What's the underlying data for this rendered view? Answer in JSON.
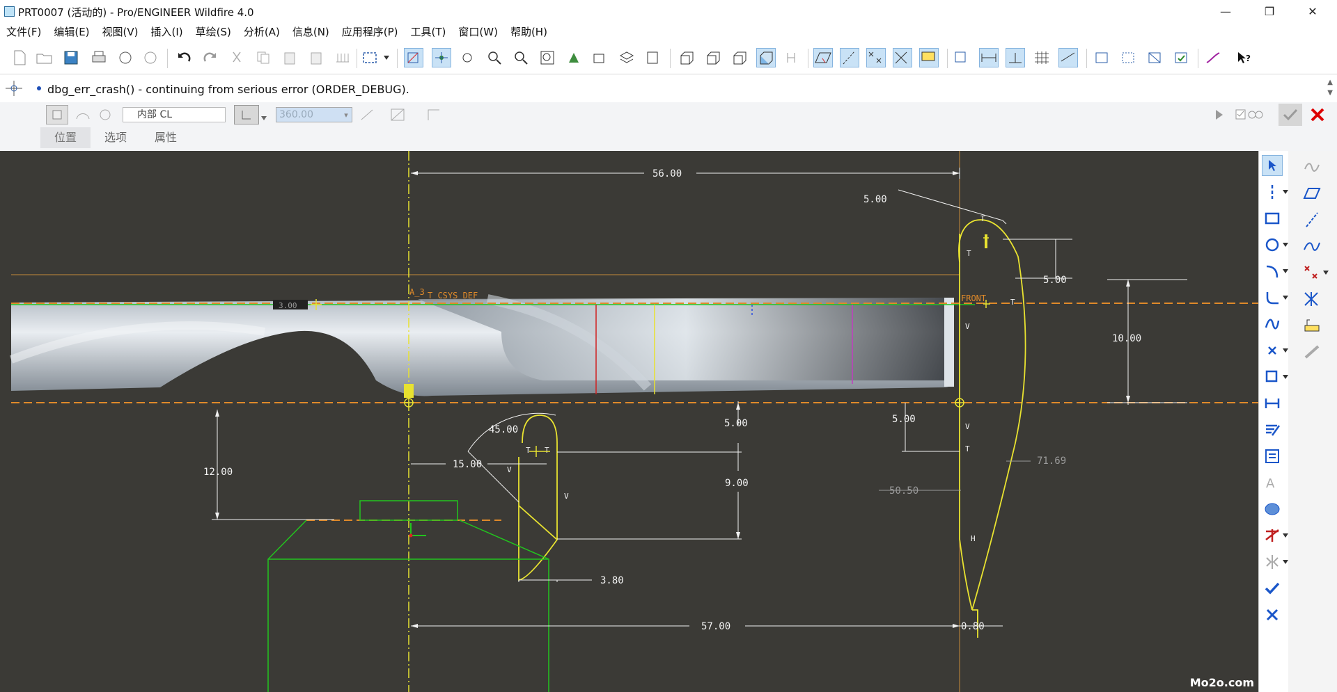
{
  "window": {
    "title": "PRT0007 (活动的) - Pro/ENGINEER Wildfire 4.0",
    "minimize": "—",
    "restore": "❐",
    "close": "✕"
  },
  "menu": [
    "文件(F)",
    "编辑(E)",
    "视图(V)",
    "插入(I)",
    "草绘(S)",
    "分析(A)",
    "信息(N)",
    "应用程序(P)",
    "工具(T)",
    "窗口(W)",
    "帮助(H)"
  ],
  "message": {
    "text": "dbg_err_crash() - continuing from serious error (ORDER_DEBUG)."
  },
  "dashboard": {
    "ref_label": "内部 CL",
    "angle_value": "360.00",
    "tabs": [
      "位置",
      "选项",
      "属性"
    ]
  },
  "dimensions": {
    "d_56": "56.00",
    "d_5_top": "5.00",
    "d_5_right": "5.00",
    "d_10": "10.00",
    "d_45": "45.00",
    "d_15": "15.00",
    "d_5_mid": "5.00",
    "d_5_mid2": "5.00",
    "d_12": "12.00",
    "d_9": "9.00",
    "d_3_8": "3.80",
    "d_57": "57.00",
    "d_71_69": "71.69",
    "d_50_50": "50.50",
    "d_0_80": "0.80",
    "d_left_small": "3.00"
  },
  "labels": {
    "a3": "A_3",
    "csys": "T_CSYS_DEF",
    "front": "FRONT",
    "T": "T",
    "V": "V",
    "H": "H"
  },
  "watermark": "Mo2o.com",
  "colors": {
    "graphics_bg": "#3b3a36",
    "sketch": "#e8e230",
    "dim": "#f2f2f2",
    "axis": "#e08a2a",
    "green": "#22c41e"
  }
}
